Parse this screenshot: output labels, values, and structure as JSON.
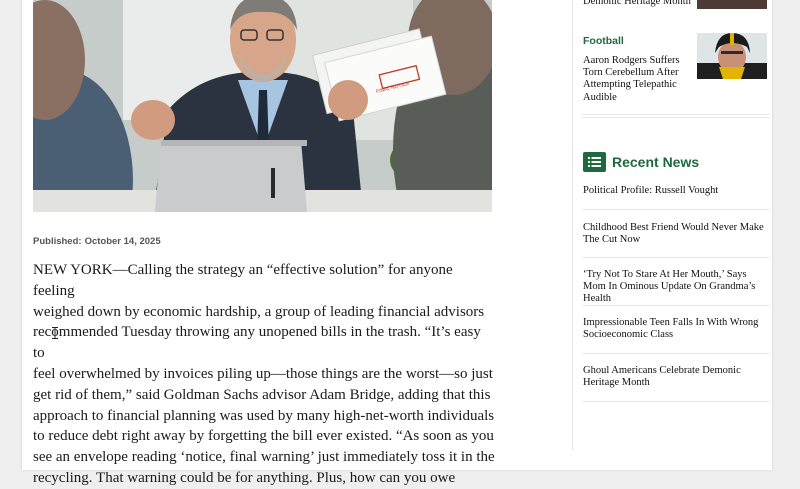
{
  "article": {
    "published_label": "Published:",
    "published_date": "October 14, 2025",
    "lines": [
      "NEW YORK—Calling the strategy an “effective solution” for anyone feeling",
      "weighed down by economic hardship, a group of leading financial advisors",
      "recommended Tuesday throwing any unopened bills in the trash. “It’s easy to",
      "feel overwhelmed by invoices piling up—those things are the worst—so just",
      "get rid of them,” said Goldman Sachs advisor Adam Bridge, adding that this",
      "approach to financial planning was used by many high-net-worth individuals",
      "to reduce debt right away by forgetting the bill ever existed. “As soon as you",
      "see an envelope reading ‘notice, final warning’ just immediately toss it in the",
      "recycling. That warning could be for anything. Plus, how can you owe"
    ],
    "envelope_stamp": "FINAL NOTICE"
  },
  "sidebar": {
    "top_item_partial": "Demonic Heritage Month",
    "football": {
      "tag": "Football",
      "headline": "Aaron Rodgers Suffers Torn Cerebellum After Attempting Telepathic Audible"
    },
    "recent_news": {
      "title": "Recent News",
      "icon": "list-icon",
      "items": [
        "Political Profile: Russell Vought",
        "Childhood Best Friend Would Never Make The Cut Now",
        "‘Try Not To Stare At Her Mouth,’ Says Mom In Ominous Update On Grandma’s Health",
        "Impressionable Teen Falls In With Wrong Socioeconomic Class",
        "Ghoul Americans Celebrate Demonic Heritage Month"
      ]
    }
  },
  "colors": {
    "accent_green": "#1d6a3f",
    "text": "#1b1b1b",
    "background": "#efefef"
  }
}
